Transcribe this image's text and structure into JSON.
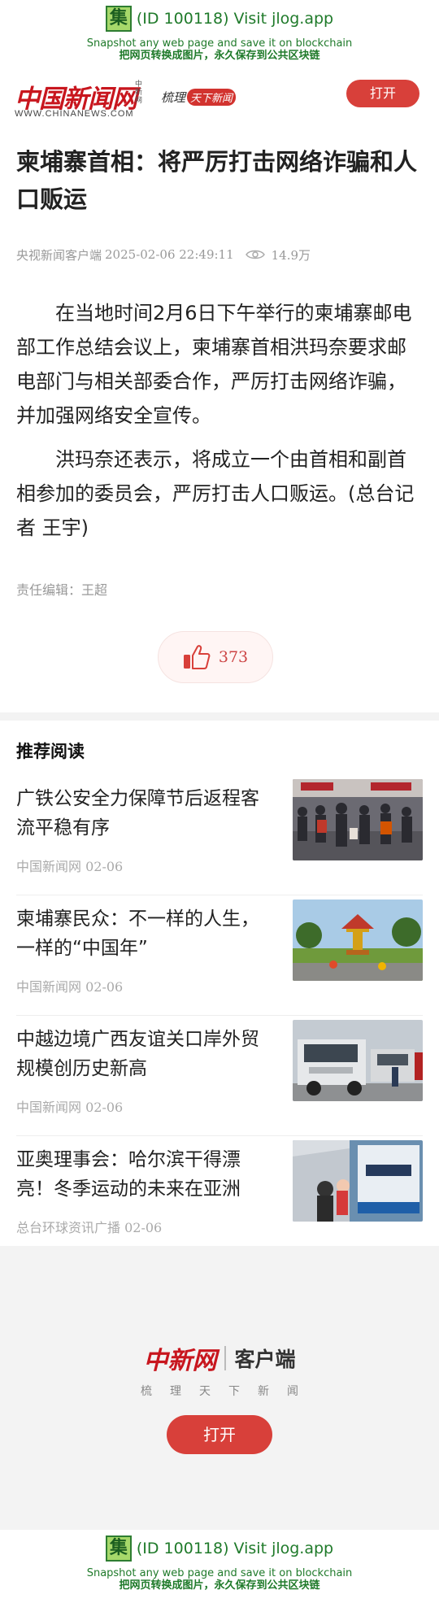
{
  "jlog_banner": {
    "badge": "集",
    "title": "(ID 100118) Visit jlog.app",
    "line_en": "Snapshot any web page and save it on blockchain",
    "line_cn": "把网页转换成图片，永久保存到公共区块链"
  },
  "header": {
    "logo_cn": "中国新闻网",
    "logo_small": "中新网",
    "logo_en": "WWW.CHINANEWS.COM",
    "slogan_a": "梳理",
    "slogan_b": "天下新闻",
    "open_label": "打开"
  },
  "article": {
    "headline": "柬埔寨首相：将严厉打击网络诈骗和人口贩运",
    "source": "央视新闻客户端",
    "time": "2025-02-06 22:49:11",
    "views": "14.9万",
    "paragraphs": [
      "在当地时间2月6日下午举行的柬埔寨邮电部工作总结会议上，柬埔寨首相洪玛奈要求邮电部门与相关部委合作，严厉打击网络诈骗，并加强网络安全宣传。",
      "洪玛奈还表示，将成立一个由首相和副首相参加的委员会，严厉打击人口贩运。(总台记者 王宇)"
    ],
    "editor": "责任编辑：王超",
    "likes": "373"
  },
  "recommended": {
    "title": "推荐阅读",
    "items": [
      {
        "title": "广铁公安全力保障节后返程客流平稳有序",
        "source": "中国新闻网 02-06"
      },
      {
        "title": "柬埔寨民众：不一样的人生，一样的“中国年”",
        "source": "中国新闻网 02-06"
      },
      {
        "title": "中越边境广西友谊关口岸外贸规模创历史新高",
        "source": "中国新闻网 02-06"
      },
      {
        "title": "亚奥理事会：哈尔滨干得漂亮！冬季运动的未来在亚洲",
        "source": "总台环球资讯广播 02-06"
      }
    ]
  },
  "footer": {
    "logo_cn": "中新网",
    "client": "客户端",
    "slogan": "梳理天下新闻",
    "open_label": "打开"
  },
  "colors": {
    "brand_red": "#c8161e",
    "button_red": "#d8403a",
    "jlog_green": "#1f7a2a"
  }
}
